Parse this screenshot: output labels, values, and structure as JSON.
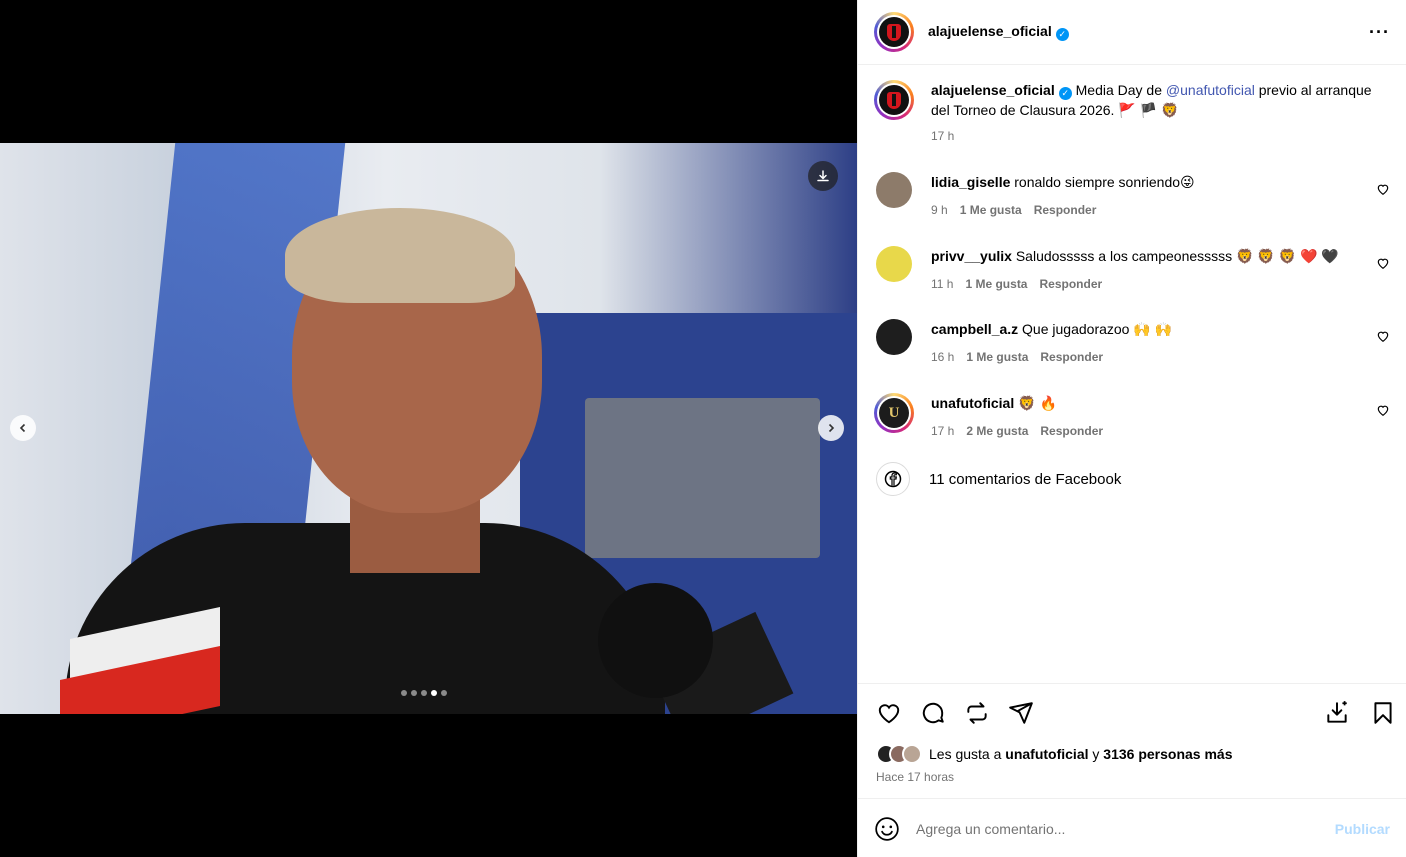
{
  "post": {
    "author": "alajuelense_oficial",
    "caption_prefix": "Media Day de ",
    "caption_mention": "@unafutoficial",
    "caption_suffix": " previo al arranque del Torneo de Clausura 2026. 🚩 🏴 🦁",
    "caption_time": "17 h",
    "carousel": {
      "slide_count": 5,
      "active_slide": 4
    }
  },
  "comments": [
    {
      "user": "lidia_giselle",
      "text": "ronaldo siempre sonriendo😜",
      "time": "9 h",
      "likes": "1 Me gusta",
      "reply": "Responder",
      "avatar_color": "#8d7b6a"
    },
    {
      "user": "privv__yulix",
      "text": "Saludosssss a los campeonesssss 🦁 🦁 🦁 ❤️ 🖤",
      "time": "11 h",
      "likes": "1 Me gusta",
      "reply": "Responder",
      "avatar_color": "#e8d84a"
    },
    {
      "user": "campbell_a.z",
      "text": "Que jugadorazoo 🙌 🙌",
      "time": "16 h",
      "likes": "1 Me gusta",
      "reply": "Responder",
      "avatar_color": "#1e1e1e"
    },
    {
      "user": "unafutoficial",
      "text": "🦁 🔥",
      "time": "17 h",
      "likes": "2 Me gusta",
      "reply": "Responder",
      "avatar_color": "#222222"
    }
  ],
  "facebook": {
    "label": "11 comentarios de Facebook"
  },
  "likes": {
    "prefix": "Les gusta a ",
    "user": "unafutoficial",
    "middle": " y ",
    "count": "3136 personas más"
  },
  "timestamp": "Hace 17 horas",
  "comment_input": {
    "placeholder": "Agrega un comentario...",
    "publish": "Publicar"
  },
  "icons": {
    "header_more": "more-icon",
    "actions": [
      "heart-icon",
      "comment-icon",
      "repost-icon",
      "share-icon",
      "save-download-icon",
      "bookmark-icon"
    ]
  },
  "colors": {
    "verified": "#0095f6",
    "mention": "#4257b0",
    "publish": "#b3dbff"
  }
}
